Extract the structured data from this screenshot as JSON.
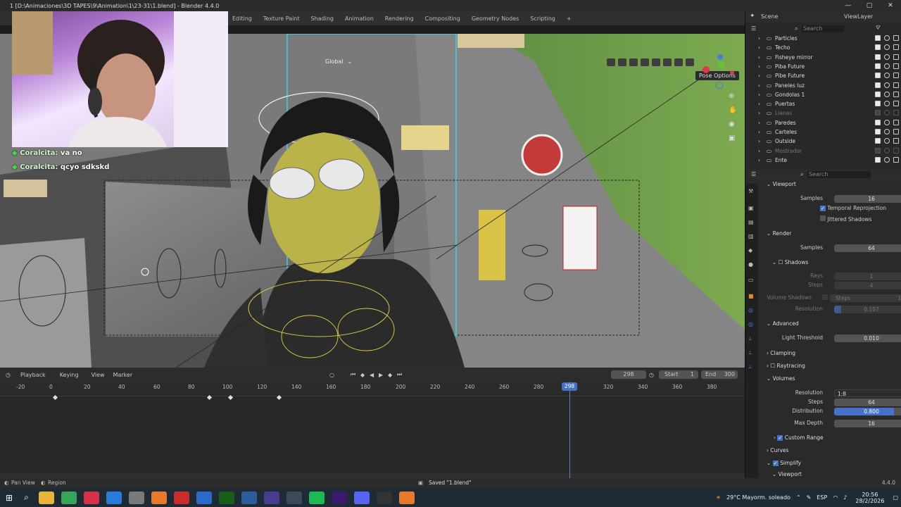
{
  "window": {
    "title": "1 [D:\\Animaciones\\3D TAPES\\9\\Animation\\1\\23-31\\1.blend] - Blender 4.4.0"
  },
  "workspaces": [
    "Editing",
    "Texture Paint",
    "Shading",
    "Animation",
    "Rendering",
    "Compositing",
    "Geometry Nodes",
    "Scripting",
    "+"
  ],
  "viewport": {
    "orientation": "Global",
    "pose_options": "Pose Options"
  },
  "chat": [
    {
      "user": "Coralcita:",
      "message": "va no"
    },
    {
      "user": "Coralcita:",
      "message": "qcyo sdkskd"
    }
  ],
  "header_right": {
    "scene": "Scene",
    "view_layer": "ViewLayer"
  },
  "outliner": {
    "search_placeholder": "Search",
    "items": [
      "Particles",
      "Techo",
      "Fisheye mirror",
      "Piba Future",
      "Pibe Future",
      "Paneles luz",
      "Gondolas 1",
      "Puertas",
      "Lianas",
      "Paredes",
      "Carteles",
      "Outside",
      "Mostrador",
      "Ente"
    ]
  },
  "properties": {
    "search_placeholder": "Search",
    "viewport_section": "Viewport",
    "viewport_samples_label": "Samples",
    "viewport_samples": "16",
    "temporal_reprojection": "Temporal Reprojection",
    "jittered_shadows": "Jittered Shadows",
    "render_section": "Render",
    "render_samples_label": "Samples",
    "render_samples": "64",
    "shadows_section": "Shadows",
    "rays_label": "Rays",
    "rays": "1",
    "steps_label": "Steps",
    "steps": "4",
    "volume_shadows_label": "Volume Shadows",
    "vol_steps_label": "Steps",
    "vol_steps": "16",
    "resolution_label": "Resolution",
    "resolution_value": "0.107",
    "advanced_section": "Advanced",
    "light_threshold_label": "Light Threshold",
    "light_threshold": "0.010",
    "clamping_section": "Clamping",
    "raytracing_section": "Raytracing",
    "volumes_section": "Volumes",
    "vol_resolution_label": "Resolution",
    "vol_resolution": "1:8",
    "vol_steps2_label": "Steps",
    "vol_steps2": "64",
    "distribution_label": "Distribution",
    "distribution": "0.800",
    "max_depth_label": "Max Depth",
    "max_depth": "16",
    "custom_range": "Custom Range",
    "curves_section": "Curves",
    "simplify_section": "Simplify",
    "viewport2_section": "Viewport"
  },
  "timeline": {
    "playback": "Playback",
    "keying": "Keying",
    "view": "View",
    "marker": "Marker",
    "current_frame": "298",
    "start_label": "Start",
    "start": "1",
    "end_label": "End",
    "end": "300",
    "ticks": [
      "-20",
      "0",
      "20",
      "40",
      "60",
      "80",
      "100",
      "120",
      "140",
      "160",
      "180",
      "200",
      "220",
      "240",
      "260",
      "280",
      "298",
      "320",
      "340",
      "360",
      "380"
    ]
  },
  "status": {
    "pan_view": "Pan View",
    "region": "Region",
    "saved": "Saved \"1.blend\"",
    "version": "4.4.0"
  },
  "taskbar": {
    "weather": "29°C  Mayorm. soleado",
    "lang": "ESP",
    "time": "20:56",
    "date": "28/2/2026"
  }
}
